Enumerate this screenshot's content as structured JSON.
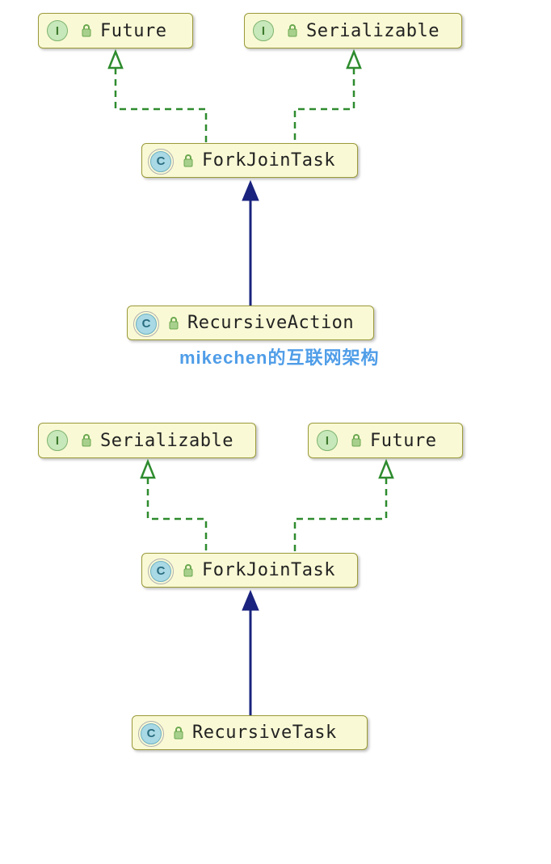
{
  "diagram1": {
    "future": {
      "kind": "I",
      "label": "Future"
    },
    "serializable": {
      "kind": "I",
      "label": "Serializable"
    },
    "forkjointask": {
      "kind": "C",
      "label": "ForkJoinTask"
    },
    "leaf": {
      "kind": "C",
      "label": "RecursiveAction"
    }
  },
  "diagram2": {
    "serializable": {
      "kind": "I",
      "label": "Serializable"
    },
    "future": {
      "kind": "I",
      "label": "Future"
    },
    "forkjointask": {
      "kind": "C",
      "label": "ForkJoinTask"
    },
    "leaf": {
      "kind": "C",
      "label": "RecursiveTask"
    }
  },
  "watermark": "mikechen的互联网架构",
  "colors": {
    "node_fill": "#f9f9d5",
    "node_border": "#9a9a3a",
    "arrow_implements": "#2e8b2e",
    "arrow_extends": "#1a237e"
  }
}
